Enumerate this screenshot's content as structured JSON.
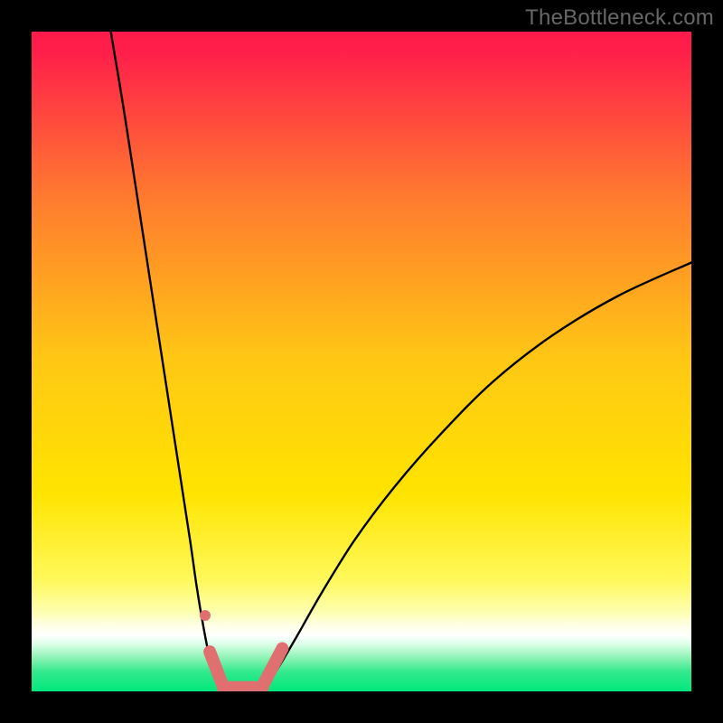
{
  "watermark": "TheBottleneck.com",
  "chart_data": {
    "type": "line",
    "title": "",
    "xlabel": "",
    "ylabel": "",
    "xlim": [
      0,
      100
    ],
    "ylim": [
      0,
      100
    ],
    "background_gradient": {
      "top_color": "#ff1a49",
      "mid_color": "#ffe400",
      "bottom_color": "#00e77a"
    },
    "series": [
      {
        "name": "left-curve",
        "x": [
          12,
          14,
          16,
          18,
          20,
          22,
          24,
          25,
          26,
          27,
          28,
          29
        ],
        "y": [
          100,
          88,
          75,
          62,
          49,
          36,
          23,
          16,
          10,
          5,
          2,
          0.5
        ]
      },
      {
        "name": "right-curve",
        "x": [
          35,
          37,
          40,
          44,
          49,
          55,
          62,
          70,
          79,
          89,
          100
        ],
        "y": [
          0.5,
          3,
          8,
          15,
          23,
          31,
          39,
          47,
          54,
          60,
          65
        ]
      },
      {
        "name": "highlight-segments",
        "color": "#e07070",
        "segments": [
          {
            "x": [
              26.3,
              26.3
            ],
            "y": [
              11.5,
              11.5
            ],
            "kind": "dot"
          },
          {
            "x": [
              27.0,
              29.0
            ],
            "y": [
              6.0,
              0.8
            ],
            "kind": "stroke"
          },
          {
            "x": [
              29.0,
              35.0
            ],
            "y": [
              0.6,
              0.6
            ],
            "kind": "stroke"
          },
          {
            "x": [
              35.0,
              38.0
            ],
            "y": [
              0.8,
              6.5
            ],
            "kind": "stroke"
          }
        ]
      }
    ]
  }
}
